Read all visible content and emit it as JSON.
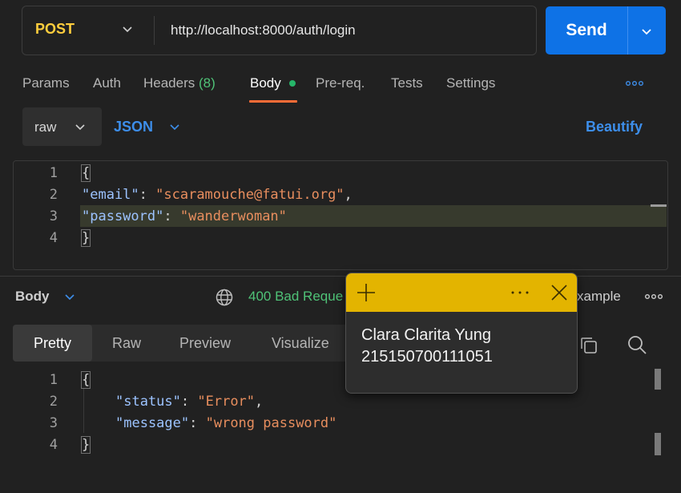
{
  "request": {
    "method": "POST",
    "url": "http://localhost:8000/auth/login",
    "send_label": "Send"
  },
  "tabs": [
    {
      "label": "Params"
    },
    {
      "label": "Auth"
    },
    {
      "label": "Headers",
      "count": "(8)"
    },
    {
      "label": "Body",
      "active": true
    },
    {
      "label": "Pre-req."
    },
    {
      "label": "Tests"
    },
    {
      "label": "Settings"
    }
  ],
  "body_options": {
    "mode": "raw",
    "language": "JSON",
    "beautify_label": "Beautify"
  },
  "request_body": {
    "line_numbers": [
      "1",
      "2",
      "3",
      "4"
    ],
    "open_brace": "{",
    "close_brace": "}",
    "email_key": "\"email\"",
    "email_value": "\"scaramouche@fatui.org\"",
    "password_key": "\"password\"",
    "password_value": "\"wanderwoman\""
  },
  "response": {
    "section_label": "Body",
    "status": "400 Bad Reque",
    "example_label": "xample",
    "view_tabs": [
      "Pretty",
      "Raw",
      "Preview",
      "Visualize"
    ],
    "line_numbers": [
      "1",
      "2",
      "3",
      "4"
    ],
    "open_brace": "{",
    "close_brace": "}",
    "status_key": "\"status\"",
    "status_value": "\"Error\"",
    "message_key": "\"message\"",
    "message_value": "\"wrong password\""
  },
  "sticky_note": {
    "line1": "Clara Clarita Yung",
    "line2": "215150700111051",
    "header_color": "#e3b400"
  },
  "colors": {
    "accent": "#0e72e6",
    "tab_underline": "#ff6c37",
    "method": "#ffce3d",
    "status_error": "#4fc277"
  }
}
